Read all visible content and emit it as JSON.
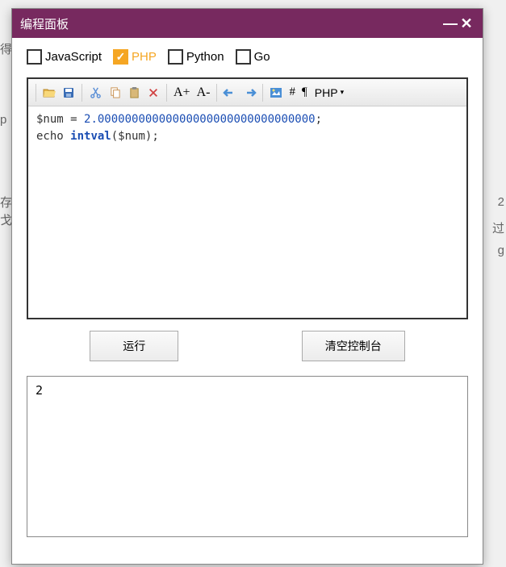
{
  "bg": {
    "t1": "得",
    "t2": "p",
    "t3": "存",
    "t4": "戈",
    "t5": "2",
    "t6": "过",
    "t7": "g"
  },
  "titlebar": {
    "title": "编程面板",
    "minimize": "—",
    "close": "✕"
  },
  "languages": [
    {
      "label": "JavaScript",
      "checked": false
    },
    {
      "label": "PHP",
      "checked": true
    },
    {
      "label": "Python",
      "checked": false
    },
    {
      "label": "Go",
      "checked": false
    }
  ],
  "toolbar": {
    "fontInc": "A+",
    "fontDec": "A-",
    "hash": "#",
    "pilcrow": "¶",
    "lang": "PHP",
    "caret": "▾"
  },
  "code": {
    "line1_var": "$num",
    "line1_eq": " = ",
    "line1_num": "2.00000000000000000000000000000000",
    "line1_semi": ";",
    "line2_echo": "echo ",
    "line2_fn": "intval",
    "line2_open": "(",
    "line2_arg": "$num",
    "line2_close": ");"
  },
  "buttons": {
    "run": "运行",
    "clear": "清空控制台"
  },
  "console": {
    "output": "2"
  }
}
